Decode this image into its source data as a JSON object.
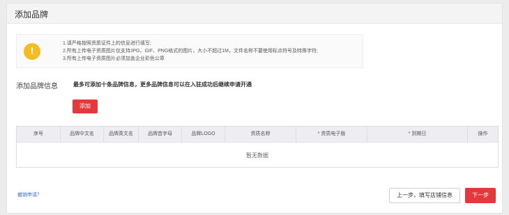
{
  "header": {
    "title": "添加品牌"
  },
  "notice": {
    "icon": "exclamation-icon",
    "icon_glyph": "!",
    "icon_color": "#f5bd22",
    "lines": [
      "1.请严格按照资质证件上的信息进行填写;",
      "2.所有上传电子资质图片仅支持JPG、GIF、PNG格式的图片，大小不超过1M，文件名称不要使用标点符号及特殊字符;",
      "3.所有上传电子资质图片必须加盖企业彩色公章"
    ]
  },
  "brand_section": {
    "label": "添加品牌信息",
    "hint": "最多可添加十条品牌信息，更多品牌信息可以在入驻成功后继续申请开通",
    "add_label": "添加"
  },
  "table": {
    "columns": [
      "序号",
      "品牌中文名",
      "品牌英文名",
      "品牌首字母",
      "品牌LOGO",
      "资质名称",
      "* 资质电子版",
      "* 到期日",
      "操作"
    ],
    "empty_text": "暂无数据"
  },
  "footer": {
    "cancel_label": "撤销申请？",
    "prev_label": "上一步，填写店铺信息",
    "next_label": "下一步"
  },
  "colors": {
    "accent": "#e4393c",
    "link": "#3a6fc2"
  }
}
